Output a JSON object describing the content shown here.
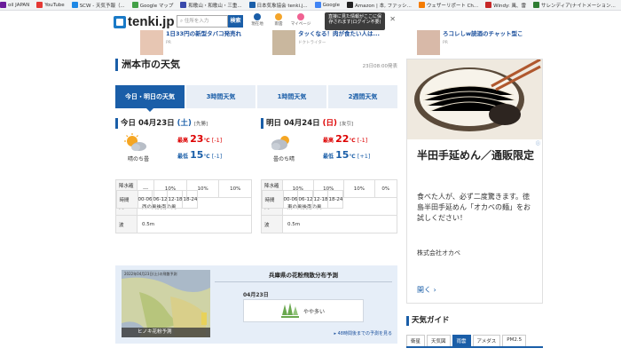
{
  "bookmarks": [
    {
      "label": "oil JAPAN",
      "color": "#6a1b9a"
    },
    {
      "label": "YouTube",
      "color": "#e53935"
    },
    {
      "label": "SCW - 天気予報（...",
      "color": "#1e88e5"
    },
    {
      "label": "Google マップ",
      "color": "#43a047"
    },
    {
      "label": "和歌山・和歌山・三重...",
      "color": "#3949ab"
    },
    {
      "label": "日本気象協会 tenki.j...",
      "color": "#1a5ea8"
    },
    {
      "label": "Google",
      "color": "#4285f4"
    },
    {
      "label": "Amazon | 本, ファッシ...",
      "color": "#222222"
    },
    {
      "label": "ウェザーリポート Ch...",
      "color": "#f57c00"
    },
    {
      "label": "Windy: 風、雷",
      "color": "#c62828"
    },
    {
      "label": "サレンディア(ナイトメーション...",
      "color": "#2e7d32"
    }
  ],
  "header": {
    "logo": "tenki.jp",
    "search_placeholder": "住所を入力",
    "search_button": "検索",
    "icons": [
      {
        "label": "現在地"
      },
      {
        "label": "雨雲"
      },
      {
        "label": "マイページ"
      }
    ],
    "tooltip": "直接に見た情報がここに保存されます(ログイン不要)"
  },
  "ads_top": [
    {
      "text": "1日33円の新型タバコ発売れ",
      "src": "PR"
    },
    {
      "text": "タッくなる！肉が食たい人は...",
      "src": "ドクトライター"
    },
    {
      "text": "ろコレしw読酒のチャット型こ",
      "src": "PR"
    }
  ],
  "main": {
    "title": "洲本市の天気",
    "updated": "23日08:00発表",
    "tabs": [
      "今日・明日の天気",
      "3時間天気",
      "1時間天気",
      "2週間天気"
    ],
    "days": [
      {
        "title_prefix": "今日 04月23日",
        "weekday": "(土)",
        "rokuyo": "[先勝]",
        "weather": "晴のち曇",
        "hi_label": "最高",
        "hi": "23",
        "hi_diff": "[-1]",
        "lo_label": "最低",
        "lo": "15",
        "lo_diff": "[-1]",
        "unit": "℃",
        "headers": [
          "時間",
          "00-06",
          "06-12",
          "12-18",
          "18-24"
        ],
        "rain_label": "降水確率",
        "rain": [
          "---",
          "10%",
          "10%",
          "10%"
        ],
        "wind_label": "風",
        "wind": "西の風後南の風",
        "wave_label": "波",
        "wave": "0.5m"
      },
      {
        "title_prefix": "明日 04月24日",
        "weekday": "(日)",
        "rokuyo": "[友引]",
        "weather": "曇のち晴",
        "hi_label": "最高",
        "hi": "22",
        "hi_diff": "[-1]",
        "lo_label": "最低",
        "lo": "15",
        "lo_diff": "[+1]",
        "unit": "℃",
        "headers": [
          "時間",
          "00-06",
          "06-12",
          "12-18",
          "18-24"
        ],
        "rain_label": "降水確率",
        "rain": [
          "10%",
          "10%",
          "10%",
          "0%"
        ],
        "wind_label": "風",
        "wind": "東の風後南の風",
        "wave_label": "波",
        "wave": "0.5m"
      }
    ]
  },
  "pollen": {
    "title": "兵庫県の花粉飛散分布予測",
    "map_caption_top": "2022年04月23日(土)の飛散予測",
    "map_caption": "ヒノキ花粉予測",
    "date": "04月23日",
    "level": "やや多い",
    "link": "48時間後までの予測を見る"
  },
  "right_ad": {
    "title": "半田手延めん／通販限定",
    "body": "食べた人が、必ず二度驚きます。徳島半田手延めん「オカベの麺」をお試しください！",
    "company": "株式会社オカベ",
    "more": "開く",
    "info_icon": "info-icon"
  },
  "guide": {
    "title": "天気ガイド",
    "tabs": [
      "衛星",
      "天気図",
      "雨雲",
      "アメダス",
      "PM2.5"
    ]
  }
}
